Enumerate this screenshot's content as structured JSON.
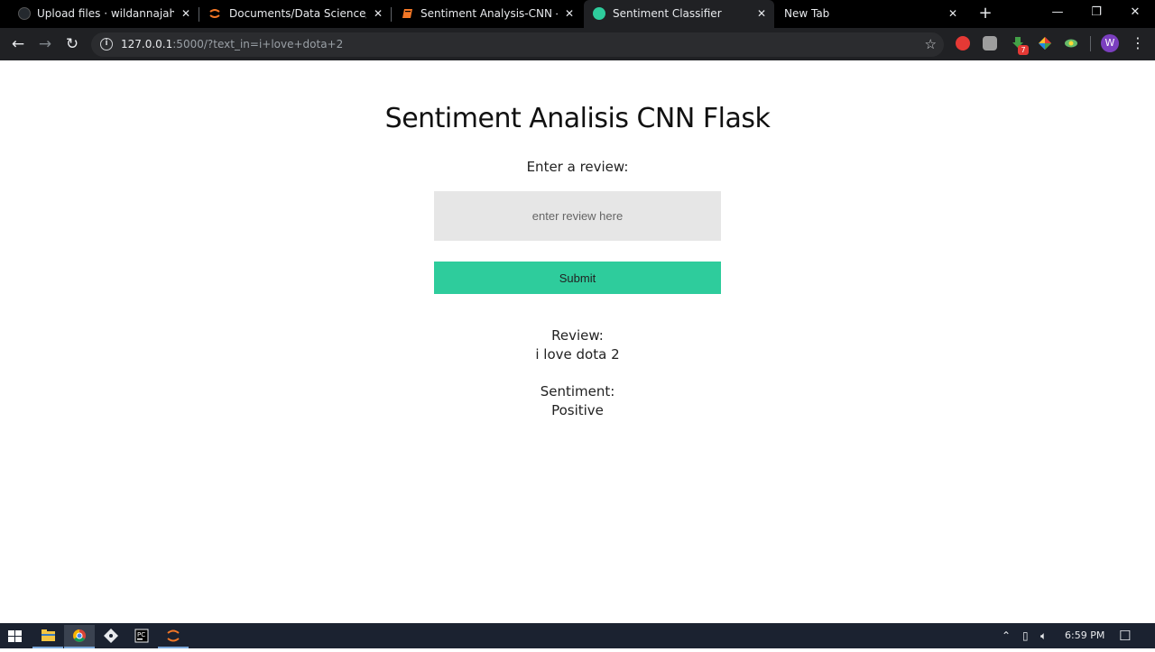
{
  "browser": {
    "tabs": [
      {
        "title": "Upload files · wildannajahw/Se",
        "close": "✕"
      },
      {
        "title": "Documents/Data Science/",
        "close": "✕"
      },
      {
        "title": "Sentiment Analysis-CNN - Jupy",
        "close": "✕"
      },
      {
        "title": "Sentiment Classifier",
        "close": "✕"
      },
      {
        "title": "New Tab",
        "close": "✕"
      }
    ],
    "new_tab": "+",
    "window_controls": {
      "minimize": "—",
      "restore": "❐",
      "close": "✕"
    },
    "url_host": "127.0.0.1",
    "url_rest": ":5000/?text_in=i+love+dota+2",
    "profile_initial": "W",
    "extension_badge": "7"
  },
  "page": {
    "title": "Sentiment Analisis CNN Flask",
    "prompt": "Enter a review:",
    "input_placeholder": "enter review here",
    "submit_label": "Submit",
    "review_label": "Review:",
    "review_value": "i love dota 2",
    "sentiment_label": "Sentiment:",
    "sentiment_value": "Positive"
  },
  "taskbar": {
    "time": "6:59 PM"
  },
  "colors": {
    "submit_button": "#2ecc9c",
    "input_background": "#e6e6e6",
    "tab_strip": "#000000",
    "toolbar": "#202124",
    "taskbar": "#1b2230"
  }
}
